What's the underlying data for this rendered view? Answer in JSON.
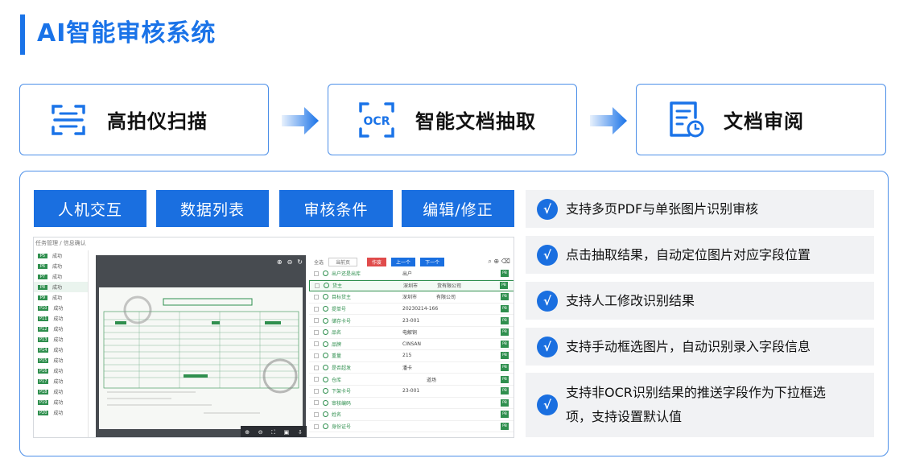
{
  "page": {
    "title": "AI智能审核系统",
    "accent": "#1a73e8"
  },
  "flow": {
    "steps": [
      {
        "label": "高拍仪扫描",
        "icon": "scan-icon"
      },
      {
        "label": "智能文档抽取",
        "icon": "ocr-icon",
        "icon_text": "OCR"
      },
      {
        "label": "文档审阅",
        "icon": "document-review-icon"
      }
    ]
  },
  "tabs": [
    {
      "label": "人机交互"
    },
    {
      "label": "数据列表"
    },
    {
      "label": "审核条件"
    },
    {
      "label": "编辑/修正"
    }
  ],
  "features": [
    {
      "text": "支持多页PDF与单张图片识别审核"
    },
    {
      "text": "点击抽取结果，自动定位图片对应字段位置"
    },
    {
      "text": "支持人工修改识别结果"
    },
    {
      "text": "支持手动框选图片，自动识别录入字段信息"
    },
    {
      "text_line1": "支持非OCR识别结果的推送字段作为下拉框选",
      "text_line2": "项，支持设置默认值"
    }
  ],
  "screenshot": {
    "breadcrumb": "任务管理 / 信息确认",
    "pages": [
      {
        "tag": "P5",
        "status": "成功"
      },
      {
        "tag": "P6",
        "status": "成功"
      },
      {
        "tag": "P7",
        "status": "成功"
      },
      {
        "tag": "P8",
        "status": "成功"
      },
      {
        "tag": "P9",
        "status": "成功"
      },
      {
        "tag": "P10",
        "status": "成功"
      },
      {
        "tag": "P11",
        "status": "成功"
      },
      {
        "tag": "P12",
        "status": "成功"
      },
      {
        "tag": "P13",
        "status": "成功"
      },
      {
        "tag": "P14",
        "status": "成功"
      },
      {
        "tag": "P15",
        "status": "成功"
      },
      {
        "tag": "P16",
        "status": "成功"
      },
      {
        "tag": "P17",
        "status": "成功"
      },
      {
        "tag": "P18",
        "status": "成功"
      },
      {
        "tag": "P19",
        "status": "成功"
      },
      {
        "tag": "P20",
        "status": "成功"
      }
    ],
    "selected_page": 3,
    "toolbar": {
      "select_all": "全选",
      "page_select": "当前页",
      "void": "作废",
      "prev": "上一个",
      "next": "下一个"
    },
    "fields": [
      {
        "name": "出户还是出库",
        "value": "出户"
      },
      {
        "name": "货主",
        "value": "深圳市　　　　货有限公司",
        "active": true
      },
      {
        "name": "目标货主",
        "value": "深圳市　　　　有限公司"
      },
      {
        "name": "提单号",
        "value": "20230214-166"
      },
      {
        "name": "储存卡号",
        "value": "23-001"
      },
      {
        "name": "品名",
        "value": "电解铜"
      },
      {
        "name": "品牌",
        "value": "CINSAN"
      },
      {
        "name": "重量",
        "value": "215"
      },
      {
        "name": "是否超发",
        "value": "潘卡"
      },
      {
        "name": "仓库",
        "value": "　　　　　道场"
      },
      {
        "name": "下架卡号",
        "value": "23-001"
      },
      {
        "name": "审核编码",
        "value": ""
      },
      {
        "name": "姓名",
        "value": ""
      },
      {
        "name": "身份证号",
        "value": ""
      }
    ],
    "field_tag": "PB"
  }
}
